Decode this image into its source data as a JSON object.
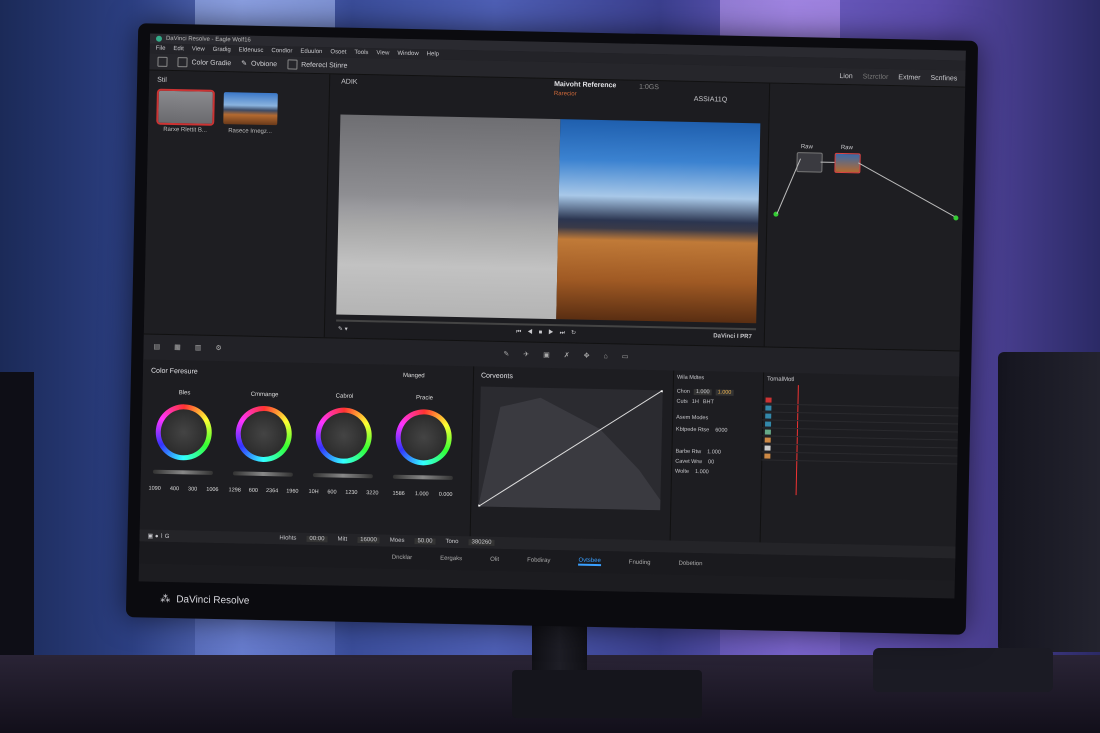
{
  "app": {
    "window_title": "DaVinci Resolve - Eagle Wolf16",
    "brand_label": "DaVinci Resolve"
  },
  "menu": [
    "File",
    "Edit",
    "View",
    "Gradig",
    "Eldenusc",
    "Condior",
    "Eduulon",
    "Osoet",
    "Tools",
    "View",
    "Window",
    "Help"
  ],
  "toolbar": {
    "color_grade": "Color Gradie",
    "tab2": "Ovbione",
    "reference": "Referecl Stinre"
  },
  "gallery": {
    "label": "Stil",
    "thumbs": [
      "Rarxe Rlettit B...",
      "Rasece Irnegz..."
    ]
  },
  "viewer": {
    "mode": "ADIK",
    "title": "Maivoht Reference",
    "title_extra": "1:0GS",
    "subtitle": "Rarecior",
    "zoom": "ASSIA11Q",
    "timecode_label": "DaVinci I PR7"
  },
  "nodes": {
    "labels": [
      "Raw",
      "Raw"
    ]
  },
  "top_right": [
    "Lion",
    "Stzrctlor",
    "Extmer",
    "Scnfines"
  ],
  "color_panel": {
    "title": "Color Feresure",
    "mode": "Manged",
    "wheels": [
      {
        "label": "Bles",
        "values": [
          "1090",
          "400",
          "300",
          "1006"
        ],
        "letters": [
          "D",
          "K",
          "E",
          "D"
        ]
      },
      {
        "label": "Cmmange",
        "values": [
          "1298",
          "600",
          "2364",
          "1960"
        ],
        "letters": [
          "K",
          "T",
          "R",
          "T"
        ]
      },
      {
        "label": "Cabrol",
        "values": [
          "10H",
          "600",
          "1230",
          "3220"
        ],
        "letters": [
          "S",
          "K",
          "F",
          "E"
        ]
      },
      {
        "label": "Pracie",
        "values": [
          "1586",
          "1.000",
          "0.000"
        ],
        "letters": [
          "P0",
          "R0",
          "F0"
        ]
      }
    ]
  },
  "curves": {
    "title": "Corveonts"
  },
  "params": {
    "section1": "Wila Mdtes",
    "rows1": [
      {
        "label": "Chon",
        "v1": "1.000",
        "v2": "1.000"
      },
      {
        "label": "Cuts",
        "v1": "1H",
        "v2": "BHT"
      }
    ],
    "section2": "Asem Modes",
    "rows2": [
      {
        "label": "Kbtpede Rtse",
        "v": "6000"
      },
      {
        "label": "Barbe Rtw",
        "v": "1.000"
      },
      {
        "label": "Cavet Wrw",
        "v": "00"
      },
      {
        "label": "Wolte",
        "v": "1.000"
      }
    ]
  },
  "timeline": {
    "title": "TomalMotl"
  },
  "status": {
    "hihts_label": "Hiohts",
    "hihts_val": "00:00",
    "mitt_label": "Mitt",
    "mitt_val": "16000",
    "moes_label": "Moes",
    "moes_val": "50.00",
    "tone_label": "Tono",
    "tone_val": "380260"
  },
  "pages": [
    "Dncklar",
    "Eergaks",
    "Olit",
    "Fobdiray",
    "Ovtsbee",
    "Fnuding",
    "Dobetion"
  ],
  "colors": {
    "accent": "#3aa0ff",
    "selected": "#cc3333"
  }
}
